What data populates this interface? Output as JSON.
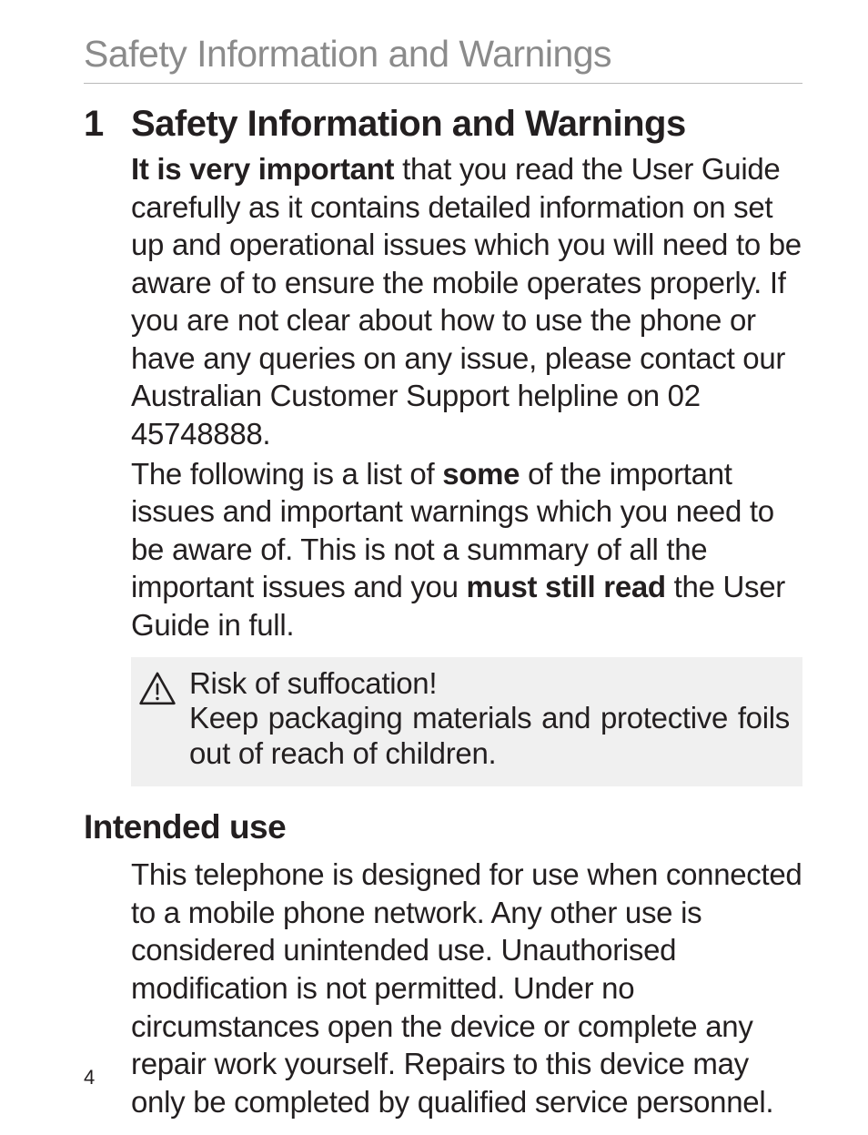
{
  "running_head": "Safety Information and Warnings",
  "section": {
    "number": "1",
    "title": "Safety Information and Warnings"
  },
  "para1": {
    "lead": "It is very important",
    "rest": " that you read the User Guide carefully as it contains detailed information on set up and operational issues which you will need to be aware of to ensure the mobile operates properly. If you are not clear about how to use the phone or have any queries on any issue, please contact our Australian Customer Support helpline on 02 45748888."
  },
  "para2": {
    "a": "The following is a list of ",
    "b": "some",
    "c": " of the important issues and important warnings which you need to be aware of. This is not a summary of all the important issues and you ",
    "d": "must still read",
    "e": " the User Guide in full."
  },
  "warning": {
    "line1": "Risk of suffocation!",
    "line2": "Keep packaging materials and protective foils out of reach of children."
  },
  "subheading": "Intended use",
  "intended_use_body": "This telephone is designed for use when connected to a mobile phone network. Any other use is considered unintended use. Unauthorised modification is not permitted. Under no circumstances open the device or complete any repair work yourself. Repairs to this device may only be completed by qualified service personnel.",
  "page_number": "4"
}
